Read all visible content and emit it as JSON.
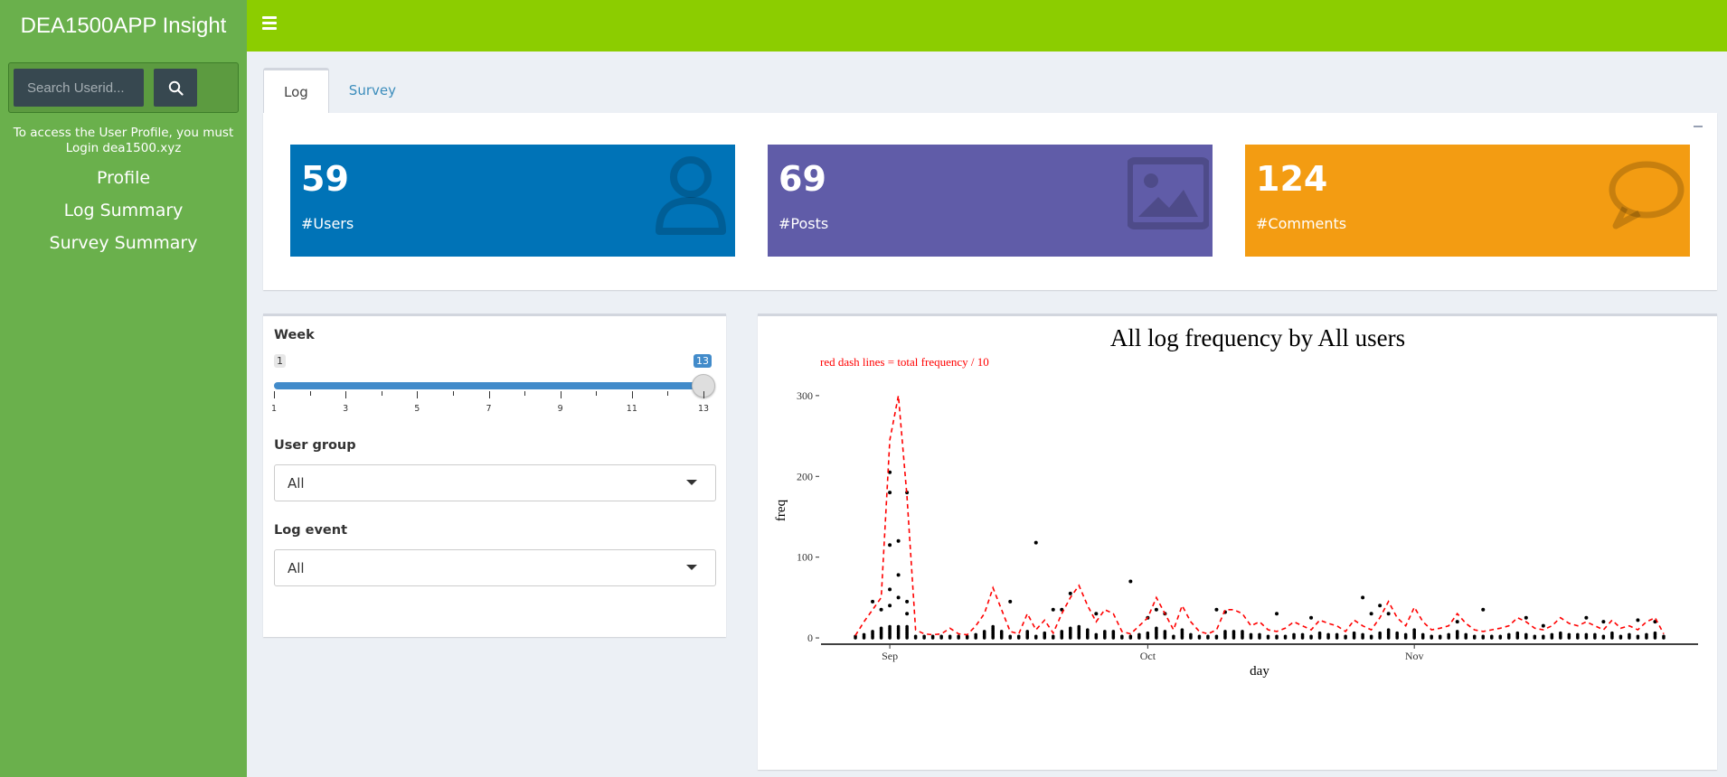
{
  "app": {
    "title": "DEA1500APP Insight"
  },
  "search": {
    "placeholder": "Search Userid..."
  },
  "sidebar": {
    "note": "To access the User Profile, you must Login dea1500.xyz",
    "items": [
      {
        "label": "Profile"
      },
      {
        "label": "Log Summary"
      },
      {
        "label": "Survey Summary"
      }
    ]
  },
  "tabs": [
    {
      "label": "Log"
    },
    {
      "label": "Survey"
    }
  ],
  "stats": [
    {
      "value": "59",
      "label": "#Users",
      "color": "#0073b7",
      "icon": "user-icon"
    },
    {
      "value": "69",
      "label": "#Posts",
      "color": "#605ca8",
      "icon": "image-icon"
    },
    {
      "value": "124",
      "label": "#Comments",
      "color": "#f39c12",
      "icon": "comment-icon"
    }
  ],
  "controls": {
    "week": {
      "label": "Week",
      "min": "1",
      "max": "13",
      "selected": [
        1,
        13
      ],
      "ticks": [
        "1",
        "3",
        "5",
        "7",
        "9",
        "11",
        "13"
      ]
    },
    "user_group": {
      "label": "User group",
      "value": "All"
    },
    "log_event": {
      "label": "Log event",
      "value": "All"
    }
  },
  "colors": {
    "sidebar": "#6ab04c",
    "header": "#8ccd00",
    "accent": "#3c8dbc"
  },
  "chart_data": {
    "type": "scatter",
    "title": "All log frequency by All users",
    "annotation": "red dash lines = total frequency / 10",
    "xlabel": "day",
    "ylabel": "freq",
    "x_ticks": [
      "Sep",
      "Oct",
      "Nov"
    ],
    "y_ticks": [
      0,
      100,
      200,
      300
    ],
    "ylim": [
      -10,
      320
    ],
    "xlim": [
      "2017-08-24",
      "2017-12-04"
    ],
    "series": [
      {
        "style": "red-dashed-line",
        "x": [
          "2017-08-28",
          "2017-08-29",
          "2017-08-30",
          "2017-08-31",
          "2017-09-01",
          "2017-09-02",
          "2017-09-03",
          "2017-09-04",
          "2017-09-05",
          "2017-09-06",
          "2017-09-07",
          "2017-09-08",
          "2017-09-09",
          "2017-09-10",
          "2017-09-11",
          "2017-09-12",
          "2017-09-13",
          "2017-09-14",
          "2017-09-15",
          "2017-09-16",
          "2017-09-17",
          "2017-09-18",
          "2017-09-19",
          "2017-09-20",
          "2017-09-21",
          "2017-09-22",
          "2017-09-23",
          "2017-09-24",
          "2017-09-25",
          "2017-09-26",
          "2017-09-27",
          "2017-09-28",
          "2017-09-29",
          "2017-09-30",
          "2017-10-01",
          "2017-10-02",
          "2017-10-03",
          "2017-10-04",
          "2017-10-05",
          "2017-10-06",
          "2017-10-07",
          "2017-10-08",
          "2017-10-09",
          "2017-10-10",
          "2017-10-11",
          "2017-10-12",
          "2017-10-13",
          "2017-10-14",
          "2017-10-15",
          "2017-10-16",
          "2017-10-17",
          "2017-10-18",
          "2017-10-19",
          "2017-10-20",
          "2017-10-21",
          "2017-10-22",
          "2017-10-23",
          "2017-10-24",
          "2017-10-25",
          "2017-10-26",
          "2017-10-27",
          "2017-10-28",
          "2017-10-29",
          "2017-10-30",
          "2017-10-31",
          "2017-11-01",
          "2017-11-02",
          "2017-11-03",
          "2017-11-04",
          "2017-11-05",
          "2017-11-06",
          "2017-11-07",
          "2017-11-08",
          "2017-11-09",
          "2017-11-10",
          "2017-11-11",
          "2017-11-12",
          "2017-11-13",
          "2017-11-14",
          "2017-11-15",
          "2017-11-16",
          "2017-11-17",
          "2017-11-18",
          "2017-11-19",
          "2017-11-20",
          "2017-11-21",
          "2017-11-22",
          "2017-11-23",
          "2017-11-24",
          "2017-11-25",
          "2017-11-26",
          "2017-11-27",
          "2017-11-28",
          "2017-11-29",
          "2017-11-30"
        ],
        "y": [
          3,
          20,
          35,
          50,
          245,
          300,
          175,
          10,
          5,
          4,
          5,
          12,
          5,
          4,
          15,
          30,
          62,
          35,
          8,
          5,
          30,
          10,
          22,
          6,
          30,
          50,
          65,
          40,
          20,
          35,
          30,
          8,
          5,
          15,
          25,
          50,
          30,
          10,
          40,
          20,
          8,
          5,
          10,
          35,
          35,
          30,
          15,
          20,
          10,
          8,
          12,
          20,
          15,
          10,
          22,
          18,
          15,
          8,
          22,
          15,
          10,
          25,
          45,
          25,
          15,
          38,
          20,
          10,
          12,
          15,
          30,
          18,
          10,
          8,
          10,
          12,
          15,
          25,
          20,
          12,
          10,
          15,
          25,
          18,
          15,
          20,
          15,
          10,
          22,
          12,
          15,
          10,
          20,
          25,
          5
        ]
      },
      {
        "style": "black-points",
        "x": [
          "2017-09-01",
          "2017-09-01",
          "2017-09-01",
          "2017-09-01",
          "2017-09-01",
          "2017-09-02",
          "2017-09-02",
          "2017-09-02",
          "2017-09-03",
          "2017-09-03",
          "2017-09-03",
          "2017-08-31",
          "2017-08-30",
          "2017-09-18",
          "2017-09-15",
          "2017-09-20",
          "2017-09-21",
          "2017-09-22",
          "2017-09-25",
          "2017-09-29",
          "2017-10-01",
          "2017-10-02",
          "2017-10-03",
          "2017-10-09",
          "2017-10-10",
          "2017-10-16",
          "2017-10-20",
          "2017-10-26",
          "2017-10-27",
          "2017-10-28",
          "2017-10-29",
          "2017-11-06",
          "2017-11-09",
          "2017-11-14",
          "2017-11-16",
          "2017-11-21",
          "2017-11-23",
          "2017-11-27",
          "2017-11-29"
        ],
        "y": [
          205,
          180,
          115,
          60,
          40,
          120,
          78,
          50,
          180,
          45,
          30,
          35,
          45,
          118,
          45,
          35,
          35,
          55,
          30,
          70,
          25,
          35,
          30,
          35,
          32,
          30,
          25,
          50,
          30,
          40,
          30,
          20,
          35,
          25,
          15,
          25,
          20,
          22,
          20
        ]
      }
    ]
  }
}
